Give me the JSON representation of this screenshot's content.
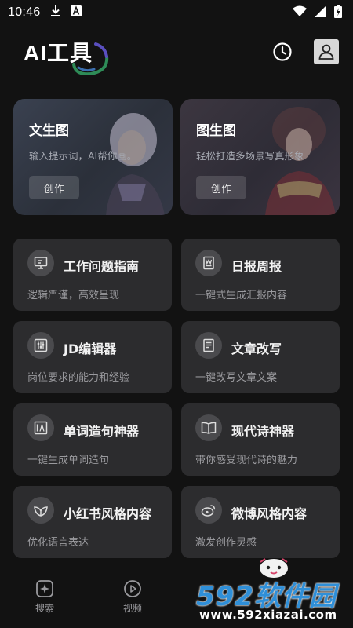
{
  "status_bar": {
    "time": "10:46",
    "icons": [
      "download-icon",
      "a-box-icon",
      "wifi-icon",
      "signal-icon",
      "battery-icon"
    ]
  },
  "header": {
    "title": "AI工具",
    "icons": [
      "history-icon",
      "profile-icon"
    ]
  },
  "feature_cards": [
    {
      "title": "文生图",
      "subtitle": "输入提示词，AI帮你画。",
      "button": "创作"
    },
    {
      "title": "图生图",
      "subtitle": "轻松打造多场景写真形象",
      "button": "创作"
    }
  ],
  "tools": [
    {
      "title": "工作问题指南",
      "desc": "逻辑严谨，高效呈现",
      "icon": "monitor-icon"
    },
    {
      "title": "日报周报",
      "desc": "一键式生成汇报内容",
      "icon": "word-doc-icon"
    },
    {
      "title": "JD编辑器",
      "desc": "岗位要求的能力和经验",
      "icon": "sliders-icon"
    },
    {
      "title": "文章改写",
      "desc": "一键改写文章文案",
      "icon": "document-icon"
    },
    {
      "title": "单词造句神器",
      "desc": "一键生成单词造句",
      "icon": "text-image-icon"
    },
    {
      "title": "现代诗神器",
      "desc": "带你感受现代诗的魅力",
      "icon": "book-icon"
    },
    {
      "title": "小红书风格内容",
      "desc": "优化语言表达",
      "icon": "leaf-icon"
    },
    {
      "title": "微博风格内容",
      "desc": "激发创作灵感",
      "icon": "weibo-icon"
    }
  ],
  "bottom_nav": [
    {
      "label": "搜索",
      "icon": "sparkle-search-icon"
    },
    {
      "label": "视频",
      "icon": "play-circle-icon"
    }
  ],
  "watermark": {
    "brand": "592软件园",
    "url": "www.592xiazai.com"
  },
  "colors": {
    "background": "#121212",
    "card": "#2c2c2e",
    "watermark_blue": "#2f8fd8"
  }
}
